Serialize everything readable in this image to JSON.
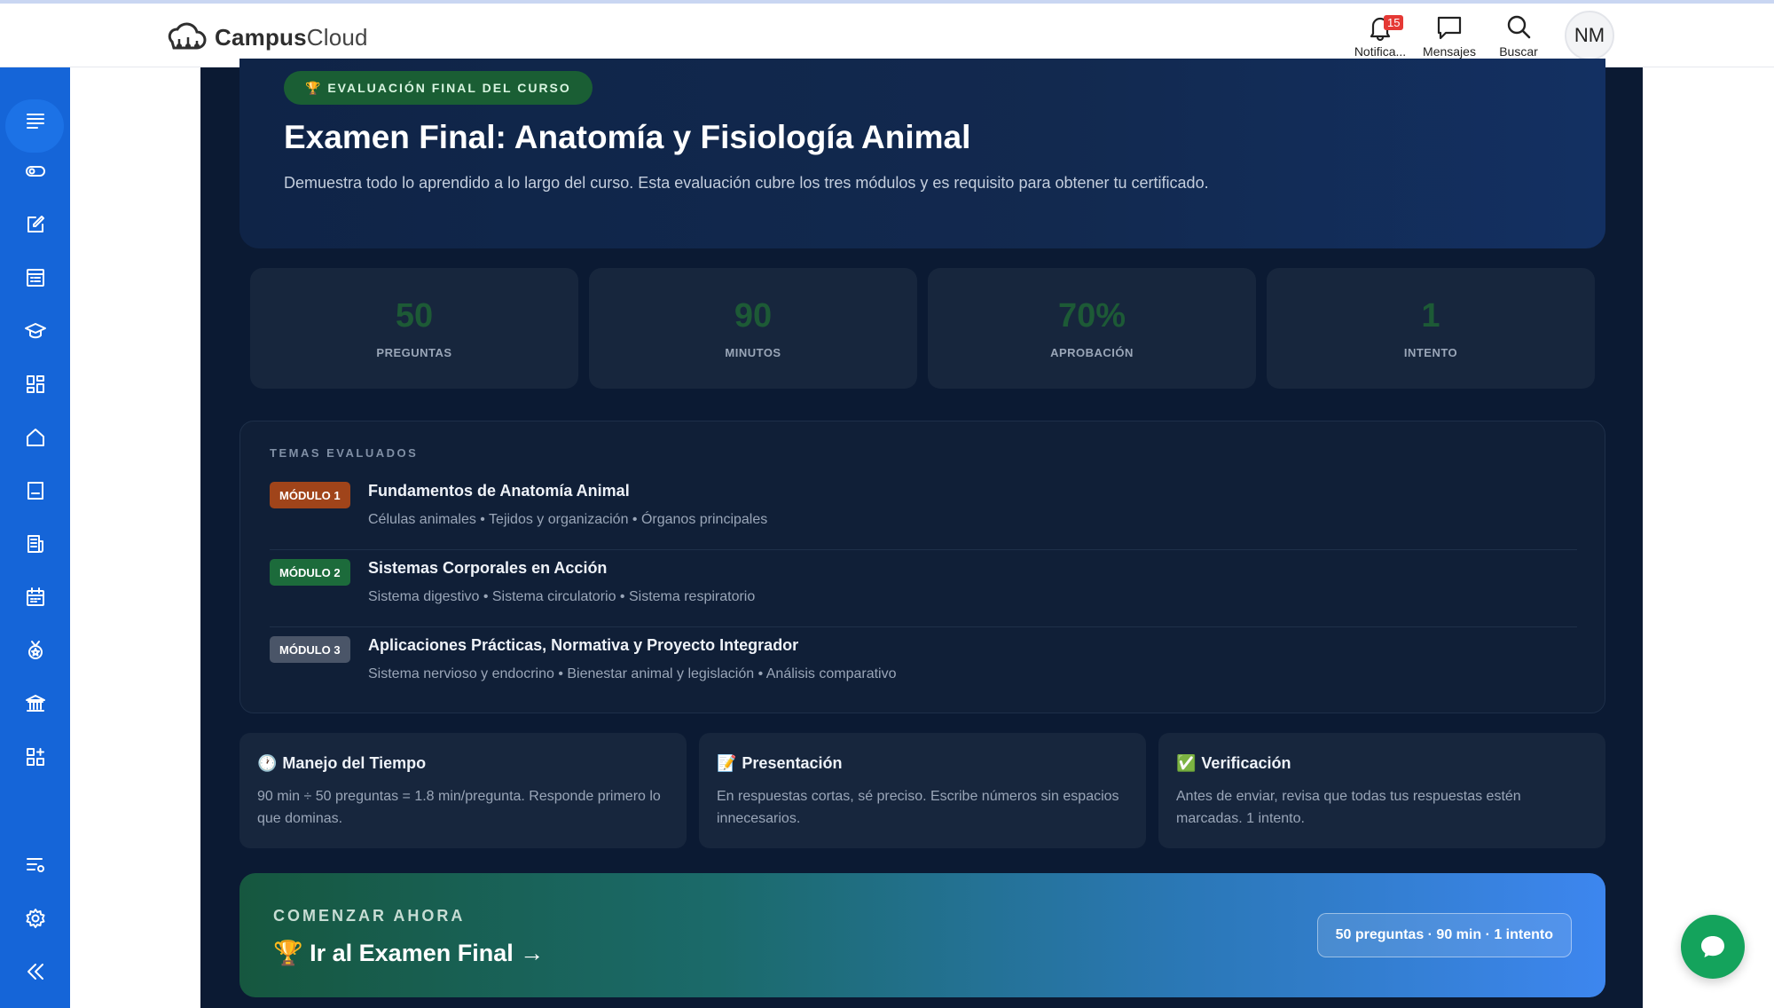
{
  "header": {
    "logo_bold": "Campus",
    "logo_light": "Cloud",
    "notifications_label": "Notifica...",
    "notifications_count": "15",
    "messages_label": "Mensajes",
    "search_label": "Buscar",
    "avatar_initials": "NM"
  },
  "sidebar": {
    "items": [
      "menu-icon",
      "toggle-icon",
      "edit-icon",
      "list-icon",
      "graduation-cap-icon",
      "grid-icon",
      "home-icon",
      "book-icon",
      "document-icon",
      "calendar-icon",
      "medal-icon",
      "institution-icon",
      "apps-add-icon",
      "filter-settings-icon",
      "gear-icon",
      "collapse-icon"
    ]
  },
  "hero": {
    "badge": "🏆 EVALUACIÓN FINAL DEL CURSO",
    "title": "Examen Final: Anatomía y Fisiología Animal",
    "description": "Demuestra todo lo aprendido a lo largo del curso. Esta evaluación cubre los tres módulos y es requisito para obtener tu certificado."
  },
  "stats": [
    {
      "value": "50",
      "label": "PREGUNTAS"
    },
    {
      "value": "90",
      "label": "MINUTOS"
    },
    {
      "value": "70%",
      "label": "APROBACIÓN"
    },
    {
      "value": "1",
      "label": "INTENTO"
    }
  ],
  "topics": {
    "title": "TEMAS EVALUADOS",
    "modules": [
      {
        "tag": "MÓDULO 1",
        "color": "#a0441a",
        "name": "Fundamentos de Anatomía Animal",
        "sub": "Células animales • Tejidos y organización • Órganos principales"
      },
      {
        "tag": "MÓDULO 2",
        "color": "#1c6b3b",
        "name": "Sistemas Corporales en Acción",
        "sub": "Sistema digestivo • Sistema circulatorio • Sistema respiratorio"
      },
      {
        "tag": "MÓDULO 3",
        "color": "#4a5568",
        "name": "Aplicaciones Prácticas, Normativa y Proyecto Integrador",
        "sub": "Sistema nervioso y endocrino • Bienestar animal y legislación • Análisis comparativo"
      }
    ]
  },
  "tips": [
    {
      "icon": "🕐",
      "title": "Manejo del Tiempo",
      "text": "90 min ÷ 50 preguntas = 1.8 min/pregunta. Responde primero lo que dominas."
    },
    {
      "icon": "📝",
      "title": "Presentación",
      "text": "En respuestas cortas, sé preciso. Escribe números sin espacios innecesarios."
    },
    {
      "icon": "✅",
      "title": "Verificación",
      "text": "Antes de enviar, revisa que todas tus respuestas estén marcadas. 1 intento."
    }
  ],
  "cta": {
    "eyebrow": "COMENZAR AHORA",
    "title": "🏆 Ir al Examen Final →",
    "chip": "50 preguntas · 90 min · 1 intento"
  }
}
